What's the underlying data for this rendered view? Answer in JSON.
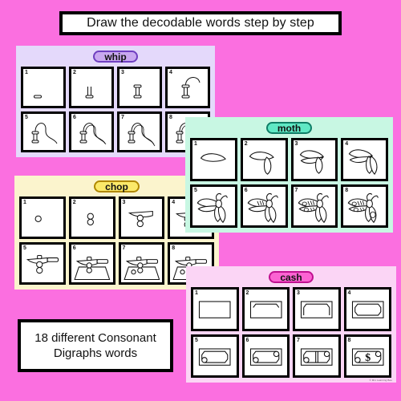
{
  "page": {
    "background_color": "#fb6fe0",
    "title": "Draw the decodable words step by step",
    "footer_note_line1": "18 different Consonant",
    "footer_note_line2": "Digraphs words",
    "credit": "© Mrs Learning Bee"
  },
  "cards": [
    {
      "id": "whip",
      "word": "whip",
      "background_color": "#e4d9fb",
      "pill_color": "#c9a8f0",
      "pill_border_color": "#6f3fc0",
      "steps": [
        "1",
        "2",
        "3",
        "4",
        "5",
        "6",
        "7",
        "8"
      ],
      "step_descriptions": [
        "small handle base",
        "handle with shaft lines",
        "full handle grip",
        "handle with curved lash start",
        "handle with long curling lash",
        "handle with full s-curve lash",
        "handle with detailed double-line lash",
        "completed whip"
      ]
    },
    {
      "id": "chop",
      "word": "chop",
      "background_color": "#fbf4cd",
      "pill_color": "#fbe96a",
      "pill_border_color": "#b08800",
      "steps": [
        "1",
        "2",
        "3",
        "4",
        "5",
        "6",
        "7",
        "8"
      ],
      "step_descriptions": [
        "single small circle",
        "two stacked circles",
        "blade outline over circles",
        "blade with handle knob",
        "cleaver with full handle",
        "cleaver on chopping block",
        "cleaver, block and extra piece",
        "finished chopping scene"
      ]
    },
    {
      "id": "moth",
      "word": "moth",
      "background_color": "#c8f7e3",
      "pill_color": "#5fe8c4",
      "pill_border_color": "#0f7d66",
      "steps": [
        "1",
        "2",
        "3",
        "4",
        "5",
        "6",
        "7",
        "8"
      ],
      "step_descriptions": [
        "single upper wing",
        "upper wing plus body",
        "two wings left side",
        "both wing pairs",
        "wings with antennae",
        "body segments added",
        "wing pattern markings",
        "completed moth"
      ]
    },
    {
      "id": "cash",
      "word": "cash",
      "background_color": "#fbd5f5",
      "pill_color": "#fb63d2",
      "pill_border_color": "#c01090",
      "steps": [
        "1",
        "2",
        "3",
        "4",
        "5",
        "6",
        "7",
        "8"
      ],
      "step_descriptions": [
        "plain banknote rectangle",
        "note with top corners clipped",
        "note with left side clipped",
        "note with all corners clipped",
        "note with one seal circle",
        "note with two seal circles",
        "note with centre divider",
        "completed dollar bill"
      ]
    }
  ]
}
